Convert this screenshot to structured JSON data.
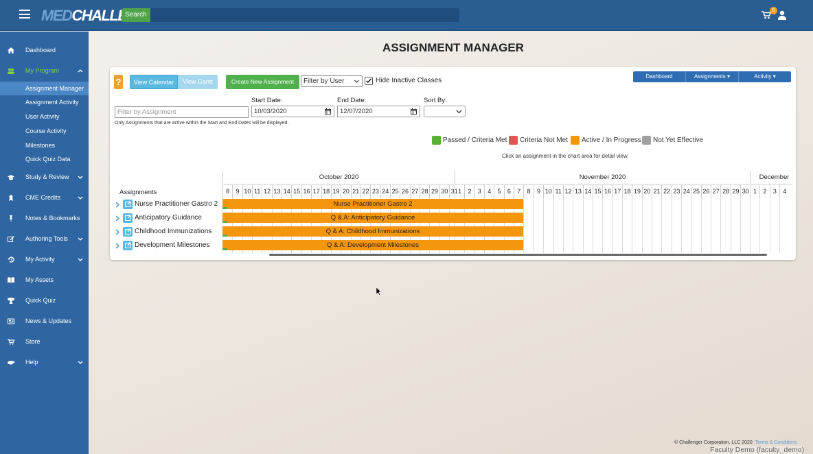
{
  "header": {
    "logo_med": "MED",
    "logo_challenger": "CHALLENGER",
    "search_label": "Search",
    "cart_count": "0"
  },
  "sidebar": {
    "items": [
      {
        "label": "Dashboard",
        "icon": "home-icon"
      },
      {
        "label": "My Program",
        "icon": "users-icon",
        "expanded": true
      },
      {
        "label": "Study & Review",
        "icon": "graduation-cap-icon"
      },
      {
        "label": "CME Credits",
        "icon": "award-icon"
      },
      {
        "label": "Notes & Bookmarks",
        "icon": "pin-icon"
      },
      {
        "label": "Authoring Tools",
        "icon": "edit-icon"
      },
      {
        "label": "My Activity",
        "icon": "history-icon"
      },
      {
        "label": "My Assets",
        "icon": "book-icon"
      },
      {
        "label": "Quick Quiz",
        "icon": "trophy-icon"
      },
      {
        "label": "News & Updates",
        "icon": "newspaper-icon"
      },
      {
        "label": "Store",
        "icon": "cart-icon"
      },
      {
        "label": "Help",
        "icon": "help-icon"
      }
    ],
    "subitems": [
      {
        "label": "Assignment Manager",
        "active": true
      },
      {
        "label": "Assignment Activity"
      },
      {
        "label": "User Activity"
      },
      {
        "label": "Course Activity"
      },
      {
        "label": "Milestones"
      },
      {
        "label": "Quick Quiz Data"
      }
    ]
  },
  "page": {
    "title": "ASSIGNMENT MANAGER"
  },
  "toolbar": {
    "help_label": "?",
    "view_calendar": "View Calendar",
    "view_gantt": "View Gantt",
    "create_new": "Create New Assignment",
    "filter_user": "Filter by User",
    "hide_inactive": "Hide Inactive Classes",
    "hide_inactive_checked": true,
    "nav_dashboard": "Dashboard",
    "nav_assignments": "Assignments",
    "nav_activity": "Activity"
  },
  "filters": {
    "assignment_placeholder": "Filter by Assignment",
    "start_label": "Start Date:",
    "start_value": "10/03/2020",
    "end_label": "End Date:",
    "end_value": "12/07/2020",
    "sort_label": "Sort By:",
    "sort_value": "",
    "note": "Only Assignments that are active within the Start and End Dates will be displayed."
  },
  "legend": [
    {
      "label": "Passed / Criteria Met",
      "color": "#5ab034"
    },
    {
      "label": "Criteria Not Met",
      "color": "#e05555"
    },
    {
      "label": "Active / In Progress",
      "color": "#f5960f"
    },
    {
      "label": "Not Yet Effective",
      "color": "#a0a0a0"
    }
  ],
  "chart_hint": "Click an assignment in the chart area for detail view.",
  "gantt": {
    "assignments_header": "Assignments",
    "months": [
      {
        "label": "October 2020"
      },
      {
        "label": "November 2020"
      },
      {
        "label": "December"
      }
    ],
    "october_days": [
      "8",
      "9",
      "10",
      "11",
      "12",
      "13",
      "14",
      "15",
      "16",
      "17",
      "18",
      "19",
      "20",
      "21",
      "22",
      "23",
      "24",
      "25",
      "26",
      "27",
      "28",
      "29",
      "30",
      "31"
    ],
    "november_days": [
      "1",
      "2",
      "3",
      "4",
      "5",
      "6",
      "7",
      "8",
      "9",
      "10",
      "11",
      "12",
      "13",
      "14",
      "15",
      "16",
      "17",
      "18",
      "19",
      "20",
      "21",
      "22",
      "23",
      "24",
      "25",
      "26",
      "27",
      "28",
      "29",
      "30"
    ],
    "december_days": [
      "1",
      "2",
      "3",
      "4"
    ],
    "rows": [
      {
        "name": "Nurse Practitioner Gastro 2",
        "bar": "Nurse Practitioner Gastro 2"
      },
      {
        "name": "Anticipatory Guidance",
        "bar": "Q & A: Anticipatory Guidance"
      },
      {
        "name": "Childhood Immunizations",
        "bar": "Q & A: Childhood Immunizations"
      },
      {
        "name": "Development Milestones",
        "bar": "Q & A: Development Milestones"
      }
    ]
  },
  "footer": {
    "copyright": "© Challenger Corporation, LLC 2020",
    "terms": "Terms & Conditions",
    "user": "Faculty Demo (faculty_demo)"
  }
}
